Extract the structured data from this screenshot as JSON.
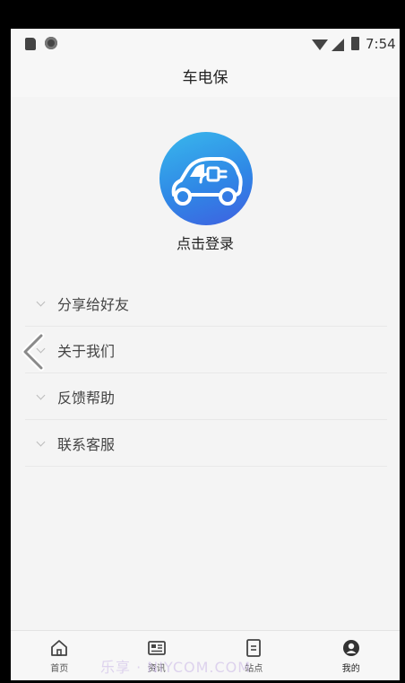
{
  "status_bar": {
    "time": "7:54",
    "icons": [
      "sd-card-icon",
      "notification-dot-icon",
      "wifi-icon",
      "signal-icon",
      "battery-icon"
    ]
  },
  "header": {
    "title": "车电保"
  },
  "profile": {
    "avatar_icon": "electric-car-icon",
    "login_text": "点击登录",
    "avatar_colors": [
      "#39b8ec",
      "#2f88e6",
      "#3f5fe0"
    ]
  },
  "menu": {
    "items": [
      {
        "label": "分享给好友",
        "icon": "chevron-down-icon"
      },
      {
        "label": "关于我们",
        "icon": "chevron-down-icon"
      },
      {
        "label": "反馈帮助",
        "icon": "chevron-down-icon"
      },
      {
        "label": "联系客服",
        "icon": "chevron-down-icon"
      }
    ]
  },
  "bottom_nav": {
    "items": [
      {
        "label": "首页",
        "icon": "home-icon",
        "active": false
      },
      {
        "label": "资讯",
        "icon": "news-icon",
        "active": false
      },
      {
        "label": "站点",
        "icon": "station-icon",
        "active": false
      },
      {
        "label": "我的",
        "icon": "profile-icon",
        "active": true
      }
    ]
  },
  "overlay": {
    "back_icon": "back-chevron-icon",
    "watermark": "乐享 · NIYCOM.COM"
  }
}
